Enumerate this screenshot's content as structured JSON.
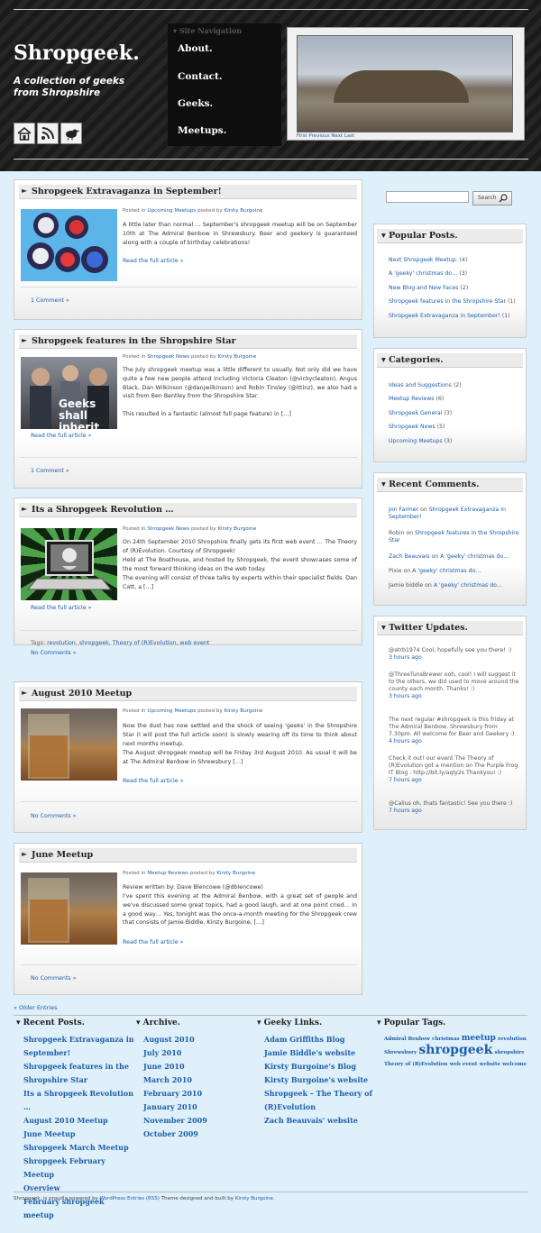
{
  "header": {
    "site_title": "Shropgeek.",
    "tagline": "A collection of geeks from Shropshire",
    "icons": [
      "home-icon",
      "rss-icon",
      "twitter-bird-icon"
    ],
    "nav_label": "Site Navigation",
    "nav_items": [
      "About.",
      "Contact.",
      "Geeks.",
      "Meetups."
    ],
    "slideshow_nav": "First Previous Next Last"
  },
  "posts": [
    {
      "title": "Shropgeek Extravaganza in September!",
      "meta_prefix": "Posted in",
      "category": "Upcoming Meetups",
      "meta_by": "posted by",
      "author": "Kirsty Burgoine",
      "excerpt": "A little later than normal … September's shropgeek meetup will be on September 10th at The Admiral Benbow in Shrewsbury. Beer and geekery is guaranteed along with a couple of birthday celebrations!",
      "read_more": "Read the full article »",
      "footer": "1 Comment »"
    },
    {
      "title": "Shropgeek features in the Shropshire Star",
      "meta_prefix": "Posted in",
      "category": "Shropgeek News",
      "meta_by": "posted by",
      "author": "Kirsty Burgoine",
      "excerpt": "The July shropgeek meetup was a little different to usually. Not only did we have quite a few new people attend including Victoria Cleaton (@vickycleaton), Angus Black, Dan Wilkinson (@danjwilkinson) and Robin Tinsley (@ittinz), we also had a visit from Ben Bentley from the Shropshire Star.",
      "excerpt2": "This resulted in a fantastic (almost full page feature) in […]",
      "thumb_text": "Geeks shall inherit",
      "read_more": "Read the full article »",
      "footer": "1 Comment »"
    },
    {
      "title": "Its a Shropgeek Revolution …",
      "meta_prefix": "Posted in",
      "category": "Shropgeek News",
      "meta_by": "posted by",
      "author": "Kirsty Burgoine",
      "excerpt": "On 24th September 2010 Shropshire finally gets its first web event … The Theory of (R)Evolution. Courtesy of Shropgeek!",
      "excerpt2": "Held at The Boathouse, and hosted by Shropgeek, the event showcases some of the most forward thinking ideas on the web today.",
      "excerpt3": "The evening will consist of three talks by experts within their specialist fields. Dan Catt, a […]",
      "read_more": "Read the full article »",
      "tags_label": "Tags:",
      "tags": [
        "revolution",
        "shropgeek",
        "Theory of (R)Evolution",
        "web event"
      ],
      "footer": "No Comments »"
    },
    {
      "title": "August 2010 Meetup",
      "meta_prefix": "Posted in",
      "category": "Upcoming Meetups",
      "meta_by": "posted by",
      "author": "Kirsty Burgoine",
      "excerpt": "Now the dust has now settled and the shock of seeing 'geeks' in the Shropshire Star (I will post the full article soon) is slowly wearing off its time to think about next months meetup.",
      "excerpt2": "The August shropgeek meetup will be Friday 3rd August 2010. As usual it will be at The Admiral Benbow in Shrewsbury […]",
      "read_more": "Read the full article »",
      "footer": "No Comments »"
    },
    {
      "title": "June Meetup",
      "meta_prefix": "Posted in",
      "category": "Meetup Reviews",
      "meta_by": "posted by",
      "author": "Kirsty Burgoine",
      "excerpt": "Review written by: Dave Blencowe (@dblencowe)",
      "excerpt2": "I've spent this evening at the Admiral Benbow, with a great set of people and we've discussed some great topics, had a good laugh, and at one point cried… In a good way… Yes, tonight was the once-a-month meeting for the Shropgeek crew that consists of Jamie Biddle, Kirsty Burgoine, […]",
      "read_more": "Read the full article »",
      "footer": "No Comments »"
    }
  ],
  "sidebar": {
    "search_button": "Search",
    "popular": {
      "title": "Popular Posts.",
      "items": [
        {
          "label": "Next Shropgeek Meetup.",
          "count": "(4)"
        },
        {
          "label": "A 'geeky' christmas do…",
          "count": "(3)"
        },
        {
          "label": "New Blog and New Faces",
          "count": "(2)"
        },
        {
          "label": "Shropgeek features in the Shropshire Star",
          "count": "(1)"
        },
        {
          "label": "Shropgeek Extravaganza in September!",
          "count": "(1)"
        }
      ]
    },
    "categories": {
      "title": "Categories.",
      "items": [
        {
          "label": "Ideas and Suggestions",
          "count": "(2)"
        },
        {
          "label": "Meetup Reviews",
          "count": "(6)"
        },
        {
          "label": "Shropgeek General",
          "count": "(3)"
        },
        {
          "label": "Shropgeek News",
          "count": "(5)"
        },
        {
          "label": "Upcoming Meetups",
          "count": "(3)"
        }
      ]
    },
    "recent_comments": {
      "title": "Recent Comments.",
      "items": [
        {
          "author": "Jon Farmer",
          "on": "on",
          "post": "Shropgeek Extravaganza in September!"
        },
        {
          "author": "Robin",
          "on": "on",
          "post": "Shropgeek features in the Shropshire Star"
        },
        {
          "author": "Zach Beauvais",
          "on": "on",
          "post": "A 'geeky' christmas do…"
        },
        {
          "author": "Pixie",
          "on": "on",
          "post": "A 'geeky' christmas do…"
        },
        {
          "author": "Jamie biddle",
          "on": "on",
          "post": "A 'geeky' christmas do…"
        }
      ]
    },
    "twitter": {
      "title": "Twitter Updates.",
      "items": [
        {
          "text": "@atrb1974 Cool, hopefully see you there! :)",
          "time": "3 hours ago"
        },
        {
          "text": "@ThreeTunsBrewer ooh, cool! I will suggest it to the others, we did used to move around the county each month. Thanks! :)",
          "time": "3 hours ago"
        },
        {
          "text": "The next regular #shropgeek is this friday at The Admiral Benbow, Shrewsbury from 7.30pm. All welcome for Beer and Geekery :)",
          "time": "4 hours ago"
        },
        {
          "text": "Check it out! our event The Theory of (R)Evolution got a mention on The Purple Frog IT Blog : http://bit.ly/aqly2s Thankyou! :)",
          "time": "7 hours ago"
        },
        {
          "text": "@Calius oh, thats fantastic! See you there :)",
          "time": "7 hours ago"
        }
      ]
    }
  },
  "older_entries": "« Older Entries",
  "footer": {
    "recent_posts": {
      "title": "Recent Posts.",
      "items": [
        "Shropgeek Extravaganza in",
        "September!",
        "Shropgeek features in the",
        "Shropshire Star",
        "Its a Shropgeek Revolution …",
        "August 2010 Meetup",
        "June Meetup",
        "Shropgeek March Meetup",
        "Shropgeek February Meetup",
        "Overview",
        "February shropgeek meetup"
      ]
    },
    "archive": {
      "title": "Archive.",
      "items": [
        "August 2010",
        "July 2010",
        "June 2010",
        "March 2010",
        "February 2010",
        "January 2010",
        "November 2009",
        "October 2009"
      ]
    },
    "geeky_links": {
      "title": "Geeky Links.",
      "items": [
        "Adam Griffiths Blog",
        "Jamie Biddle's website",
        "Kirsty Burgoine's Blog",
        "Kirsty Burgoine's website",
        "Shropgeek – The Theory of",
        "(R)Evolution",
        "Zach Beauvais' website"
      ]
    },
    "tags": {
      "title": "Popular Tags.",
      "items": [
        {
          "label": "Admiral Benbow",
          "size": "small"
        },
        {
          "label": "christmas",
          "size": "small"
        },
        {
          "label": "meetup",
          "size": "medium"
        },
        {
          "label": "revolution",
          "size": "small"
        },
        {
          "label": "Shrewsbury",
          "size": "small"
        },
        {
          "label": "shropgeek",
          "size": "large"
        },
        {
          "label": "shropshire",
          "size": "small"
        },
        {
          "label": "Theory of (R)Evolution",
          "size": "small"
        },
        {
          "label": "web event",
          "size": "small"
        },
        {
          "label": "website",
          "size": "small"
        },
        {
          "label": "welcome",
          "size": "small"
        }
      ]
    },
    "credits": {
      "prefix": "Shropgeek. is proudly powered by",
      "wordpress": "WordPress",
      "entries": "Entries (RSS)",
      "middle": "Theme designed and built by",
      "designer": "Kirsty Burgoine."
    }
  }
}
